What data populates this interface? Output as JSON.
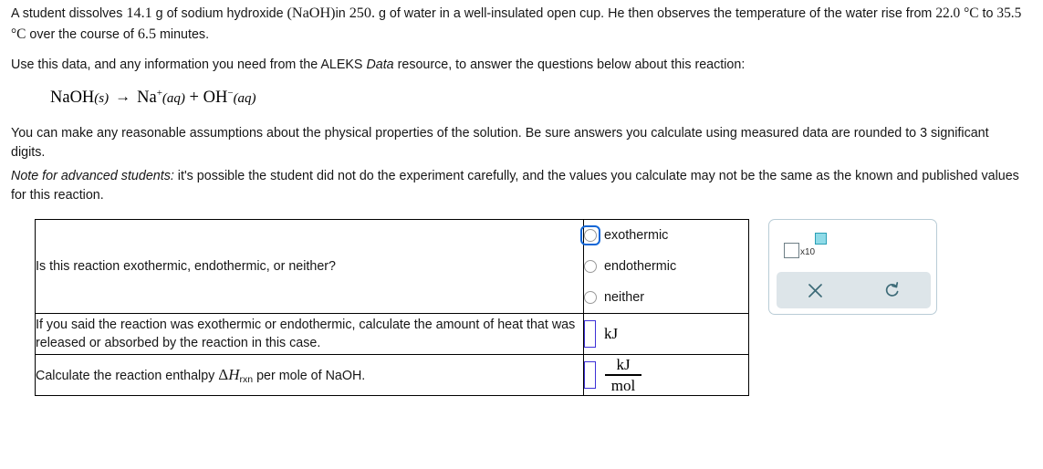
{
  "problem": {
    "intro_line1_a": "A student dissolves ",
    "intro_mass": "14.1",
    "intro_line1_b": " g of sodium hydroxide ",
    "intro_formula": "(NaOH)",
    "intro_line1_c": "in ",
    "intro_water_mass": "250.",
    "intro_line1_d": " g of water in a well-insulated open cup. He then observes the temperature of the water rise from ",
    "temp_initial": "22.0 °C",
    "intro_line1_e": " to ",
    "temp_final": "35.5 °C",
    "intro_line1_f": " over the course of ",
    "time_minutes": "6.5",
    "intro_line1_g": " minutes.",
    "data_instruction_a": "Use this data, and any information you need from the ALEKS ",
    "data_resource_name": "Data",
    "data_instruction_b": " resource, to answer the questions below about this reaction:",
    "assumptions": "You can make any reasonable assumptions about the physical properties of the solution. Be sure answers you calculate using measured data are rounded to 3 significant digits.",
    "note_label": "Note for advanced students:",
    "note_text": " it's possible the student did not do the experiment carefully, and the values you calculate may not be the same as the known and published values for this reaction."
  },
  "equation": {
    "reactant": "NaOH",
    "reactant_state": "(s)",
    "arrow": "→",
    "product1": "Na",
    "product1_charge": "+",
    "product1_state": "(aq)",
    "plus": "+",
    "product2": "OH",
    "product2_charge": "−",
    "product2_state": "(aq)"
  },
  "table": {
    "rows": [
      {
        "question": "Is this reaction exothermic, endothermic, or neither?",
        "answer_type": "radio",
        "options": [
          {
            "label": "exothermic",
            "focused": true,
            "selected": false
          },
          {
            "label": "endothermic",
            "focused": false,
            "selected": false
          },
          {
            "label": "neither",
            "focused": false,
            "selected": false
          }
        ]
      },
      {
        "question": "If you said the reaction was exothermic or endothermic, calculate the amount of heat that was released or absorbed by the reaction in this case.",
        "answer_type": "entry",
        "value": "",
        "unit": "kJ"
      },
      {
        "question_a": "Calculate the reaction enthalpy ",
        "question_symbol": "ΔH",
        "question_subscript": "rxn",
        "question_b": " per mole of NaOH.",
        "answer_type": "entry-fraction",
        "value": "",
        "unit_numerator": "kJ",
        "unit_denominator": "mol"
      }
    ]
  },
  "toolbar": {
    "sci_notation_label": "x10",
    "clear_label": "×",
    "reset_label": "↺"
  },
  "colors": {
    "focus_blue": "#1266d6",
    "entry_border": "#3d31d6",
    "panel_border": "#b9ccd6",
    "action_bg": "#dde5e9",
    "icon": "#3d6b78",
    "sci_exp_fill": "#8fdbe8"
  }
}
